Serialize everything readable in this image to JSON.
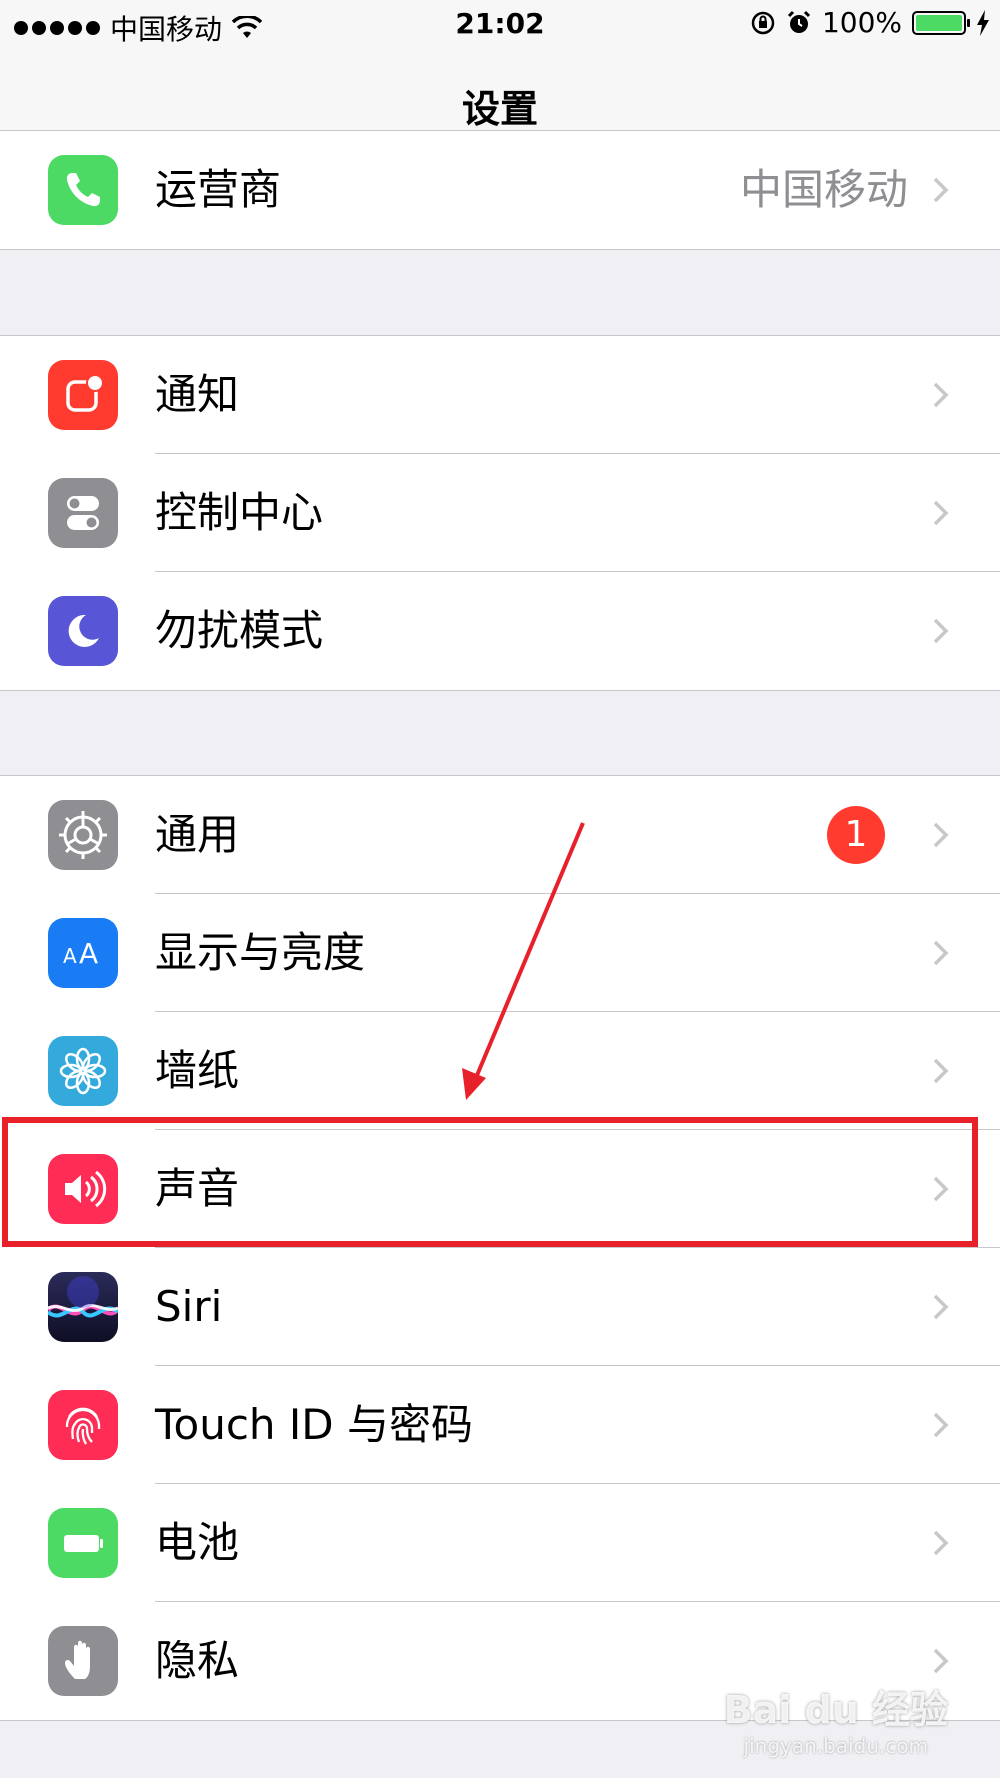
{
  "status_bar": {
    "carrier": "中国移动",
    "time": "21:02",
    "battery_percent": "100%",
    "battery_level": 1.0
  },
  "nav": {
    "title": "设置"
  },
  "group_carrier": {
    "rows": [
      {
        "label": "运营商",
        "detail": "中国移动",
        "icon": "phone-icon",
        "color": "#4cd964"
      }
    ]
  },
  "group_system": {
    "rows": [
      {
        "label": "通知",
        "icon": "notifications-icon",
        "color": "#ff3b30"
      },
      {
        "label": "控制中心",
        "icon": "control-center-icon",
        "color": "#8e8e93"
      },
      {
        "label": "勿扰模式",
        "icon": "moon-icon",
        "color": "#5856d6"
      }
    ]
  },
  "group_general": {
    "rows": [
      {
        "label": "通用",
        "icon": "gear-icon",
        "color": "#8e8e93",
        "badge": "1"
      },
      {
        "label": "显示与亮度",
        "icon": "display-icon",
        "color": "#1a7cf5"
      },
      {
        "label": "墙纸",
        "icon": "wallpaper-icon",
        "color": "#34aadc"
      },
      {
        "label": "声音",
        "icon": "speaker-icon",
        "color": "#ff2d55"
      },
      {
        "label": "Siri",
        "icon": "siri-icon",
        "color": "#1c1c3a"
      },
      {
        "label": "Touch ID 与密码",
        "icon": "fingerprint-icon",
        "color": "#ff2d55"
      },
      {
        "label": "电池",
        "icon": "battery-icon",
        "color": "#4cd964"
      },
      {
        "label": "隐私",
        "icon": "hand-icon",
        "color": "#8e8e93"
      }
    ]
  },
  "annotation": {
    "highlighted_row": "声音",
    "color": "#e8202a"
  },
  "watermark": {
    "main": "Bai du 经验",
    "sub": "jingyan.baidu.com"
  }
}
